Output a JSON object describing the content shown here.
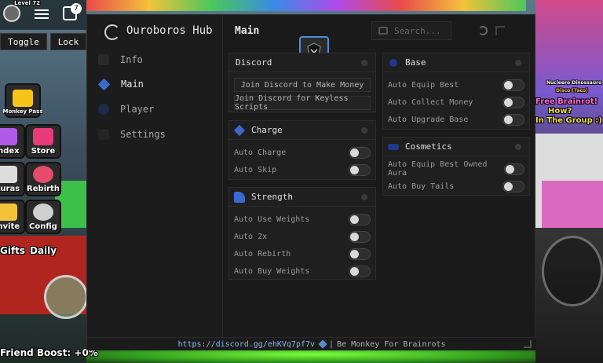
{
  "game_hud": {
    "level_label": "Level 72",
    "notification_count": "7",
    "toggle_label": "Toggle",
    "lock_label": "Lock",
    "monkey_pass_label": "Monkey Pass",
    "index_label": "Index",
    "store_label": "Store",
    "auras_label": "Auras",
    "rebirth_label": "Rebirth",
    "invite_label": "Invite",
    "config_label": "Config",
    "gifts_label": "Gifts",
    "daily_label": "Daily",
    "friend_boost_label": "Friend Boost: +0%",
    "right_npc_name": "Nucleero Dinossauro",
    "right_npc_sub": "Disco (Taco)",
    "free_brainrot_label": "Free Brainrot!",
    "how_label": "How?",
    "join_group_label": "In The Group :)"
  },
  "hub": {
    "title": "Ouroboros Hub",
    "header_title": "Main",
    "search_placeholder": "Search...",
    "nav": [
      {
        "label": "Info",
        "active": false
      },
      {
        "label": "Main",
        "active": true
      },
      {
        "label": "Player",
        "active": false
      },
      {
        "label": "Settings",
        "active": false
      }
    ],
    "sections": {
      "discord": {
        "title": "Discord",
        "buttons": [
          "Join Discord to Make Money",
          "Join Discord for Keyless Scripts"
        ]
      },
      "charge": {
        "title": "Charge",
        "toggles": [
          "Auto Charge",
          "Auto Skip"
        ]
      },
      "strength": {
        "title": "Strength",
        "toggles": [
          "Auto Use Weights",
          "Auto 2x",
          "Auto Rebirth",
          "Auto Buy Weights"
        ]
      },
      "base": {
        "title": "Base",
        "toggles": [
          "Auto Equip Best",
          "Auto Collect Money",
          "Auto Upgrade Base"
        ]
      },
      "cosmetics": {
        "title": "Cosmetics",
        "toggles": [
          "Auto Equip Best Owned Aura",
          "Auto Buy Tails"
        ]
      }
    },
    "footer": {
      "link": "https://discord.gg/ehKVq7pf7v",
      "separator": "|",
      "tagline": "Be Monkey For Brainrots"
    }
  },
  "colors": {
    "accent": "#4a90d9",
    "panel": "#1f1f1f",
    "window": "#1a1a1a"
  }
}
